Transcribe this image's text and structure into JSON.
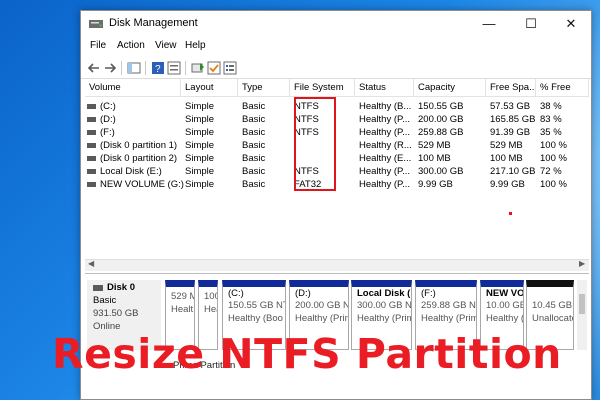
{
  "window": {
    "title": "Disk Management",
    "controls": {
      "minimize": "—",
      "maximize": "☐",
      "close": "✕"
    }
  },
  "menu": [
    "File",
    "Action",
    "View",
    "Help"
  ],
  "toolbar_icons": [
    "back-arrow-icon",
    "forward-arrow-icon",
    "console-tree-icon",
    "help-icon",
    "properties-icon",
    "refresh-icon",
    "check-icon",
    "list-icon"
  ],
  "table": {
    "columns": [
      "Volume",
      "Layout",
      "Type",
      "File System",
      "Status",
      "Capacity",
      "Free Spa...",
      "% Free"
    ],
    "rows": [
      [
        "(C:)",
        "Simple",
        "Basic",
        "NTFS",
        "Healthy (B...",
        "150.55 GB",
        "57.53 GB",
        "38 %"
      ],
      [
        "(D:)",
        "Simple",
        "Basic",
        "NTFS",
        "Healthy (P...",
        "200.00 GB",
        "165.85 GB",
        "83 %"
      ],
      [
        "(F:)",
        "Simple",
        "Basic",
        "NTFS",
        "Healthy (P...",
        "259.88 GB",
        "91.39 GB",
        "35 %"
      ],
      [
        "(Disk 0 partition 1)",
        "Simple",
        "Basic",
        "",
        "Healthy (R...",
        "529 MB",
        "529 MB",
        "100 %"
      ],
      [
        "(Disk 0 partition 2)",
        "Simple",
        "Basic",
        "",
        "Healthy (E...",
        "100 MB",
        "100 MB",
        "100 %"
      ],
      [
        "Local Disk  (E:)",
        "Simple",
        "Basic",
        "NTFS",
        "Healthy (P...",
        "300.00 GB",
        "217.10 GB",
        "72 %"
      ],
      [
        "NEW VOLUME (G:)",
        "Simple",
        "Basic",
        "FAT32",
        "Healthy (P...",
        "9.99 GB",
        "9.99 GB",
        "100 %"
      ]
    ]
  },
  "disk": {
    "name": "Disk 0",
    "type": "Basic",
    "size": "931.50 GB",
    "status": "Online",
    "partitions": [
      {
        "name": "",
        "size": "529 M",
        "status": "Healt"
      },
      {
        "name": "",
        "size": "100",
        "status": "Heal"
      },
      {
        "name": "(C:)",
        "size": "150.55 GB NT",
        "status": "Healthy (Boo"
      },
      {
        "name": "(D:)",
        "size": "200.00 GB NT",
        "status": "Healthy (Prim"
      },
      {
        "name": "Local Disk  (I",
        "size": "300.00 GB NT",
        "status": "Healthy (Prim"
      },
      {
        "name": "(F:)",
        "size": "259.88 GB NT",
        "status": "Healthy (Prim"
      },
      {
        "name": "NEW VO",
        "size": "10.00 GB",
        "status": "Healthy ("
      },
      {
        "name": "",
        "size": "10.45 GB",
        "status": "Unallocate"
      }
    ],
    "legend_text": "Prima Partition"
  },
  "overlay_caption": "Resize NTFS Partition",
  "colors": {
    "highlight": "#e0141c",
    "partition_bar": "#102a99",
    "unallocated_bar": "#111111",
    "caption": "#ea1c24"
  }
}
